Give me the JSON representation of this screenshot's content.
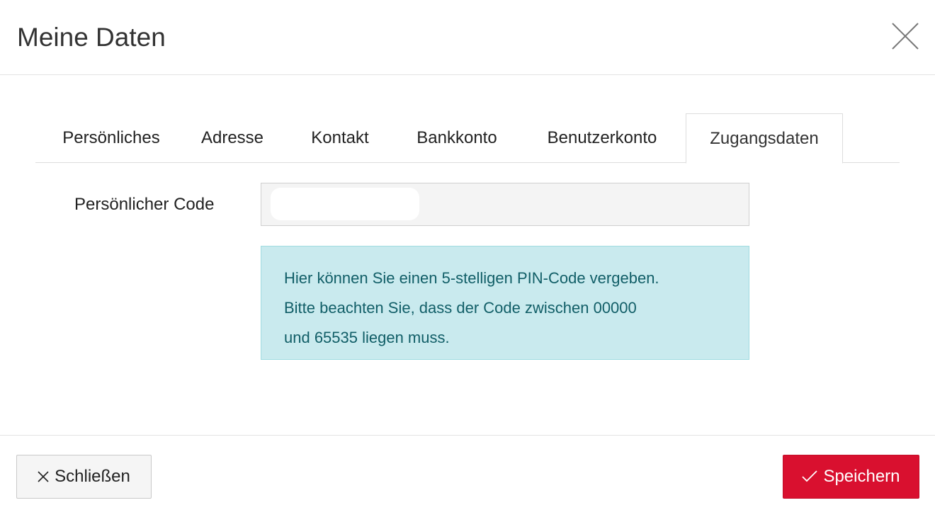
{
  "dialog": {
    "title": "Meine Daten",
    "close_icon": "close-icon"
  },
  "tabs": [
    {
      "label": "Persönliches",
      "active": false
    },
    {
      "label": "Adresse",
      "active": false
    },
    {
      "label": "Kontakt",
      "active": false
    },
    {
      "label": "Bankkonto",
      "active": false
    },
    {
      "label": "Benutzerkonto",
      "active": false
    },
    {
      "label": "Zugangsdaten",
      "active": true
    }
  ],
  "form": {
    "pin_label": "Persönlicher Code",
    "pin_value": ""
  },
  "info": {
    "lines": [
      "Hier können Sie einen 5-stelligen PIN-Code vergeben.",
      "Bitte beachten Sie, dass der Code zwischen 00000",
      "und 65535 liegen muss."
    ]
  },
  "footer": {
    "close_label": "Schließen",
    "close_icon": "x-icon",
    "save_label": "Speichern",
    "save_icon": "checkmark-icon"
  },
  "colors": {
    "accent_red": "#d9102f",
    "info_bg": "#c9eaee",
    "info_text": "#115e67"
  }
}
